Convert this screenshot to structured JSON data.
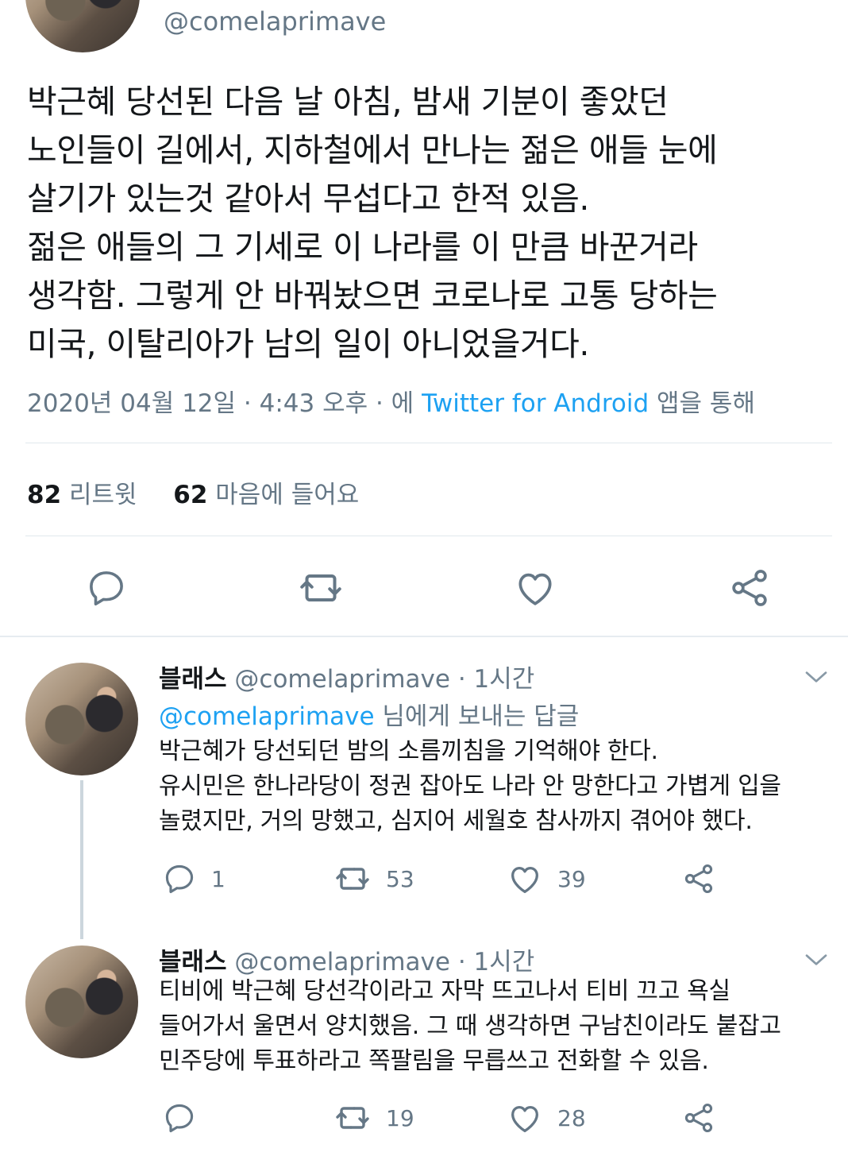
{
  "main_tweet": {
    "handle": "@comelaprimave",
    "text": "박근혜 당선된 다음 날 아침, 밤새 기분이 좋았던\n노인들이 길에서, 지하철에서 만나는 젊은 애들 눈에\n살기가 있는것 같아서 무섭다고 한적 있음.\n젊은 애들의 그 기세로 이 나라를 이 만큼 바꾼거라\n생각함. 그렇게 안 바꿔놨으면 코로나로 고통 당하는\n미국, 이탈리아가 남의 일이 아니었을거다.",
    "date": "2020년 04월 12일 · 4:43 오후 · 에",
    "source": "Twitter for Android",
    "source_suffix": "앱을 통해",
    "retweet_count": "82",
    "retweet_label": "리트윗",
    "like_count": "62",
    "like_label": "마음에 들어요"
  },
  "replies": [
    {
      "name": "블래스",
      "handle": "@comelaprimave",
      "time": "· 1시간",
      "reply_to_mention": "@comelaprimave",
      "reply_to_suffix": "님에게 보내는 답글",
      "text": "박근혜가 당선되던 밤의 소름끼침을 기억해야 한다.\n유시민은 한나라당이 정권 잡아도 나라 안 망한다고 가볍게 입을\n놀렸지만, 거의 망했고, 심지어 세월호 참사까지 겪어야 했다.",
      "replies": "1",
      "retweets": "53",
      "likes": "39"
    },
    {
      "name": "블래스",
      "handle": "@comelaprimave",
      "time": "· 1시간",
      "text": "티비에 박근혜 당선각이라고 자막 뜨고나서 티비 끄고 욕실\n들어가서 울면서 양치했음. 그 때 생각하면 구남친이라도 붙잡고\n민주당에 투표하라고 쪽팔림을 무릅쓰고 전화할 수 있음.",
      "replies": "",
      "retweets": "19",
      "likes": "28"
    }
  ],
  "icons": {
    "reply": "reply-icon",
    "retweet": "retweet-icon",
    "like": "heart-icon",
    "share": "share-icon",
    "caret": "chevron-down-icon"
  },
  "colors": {
    "link": "#1da1f2",
    "secondary_text": "#657786",
    "icon": "#657786",
    "divider": "#e1e8ed"
  }
}
